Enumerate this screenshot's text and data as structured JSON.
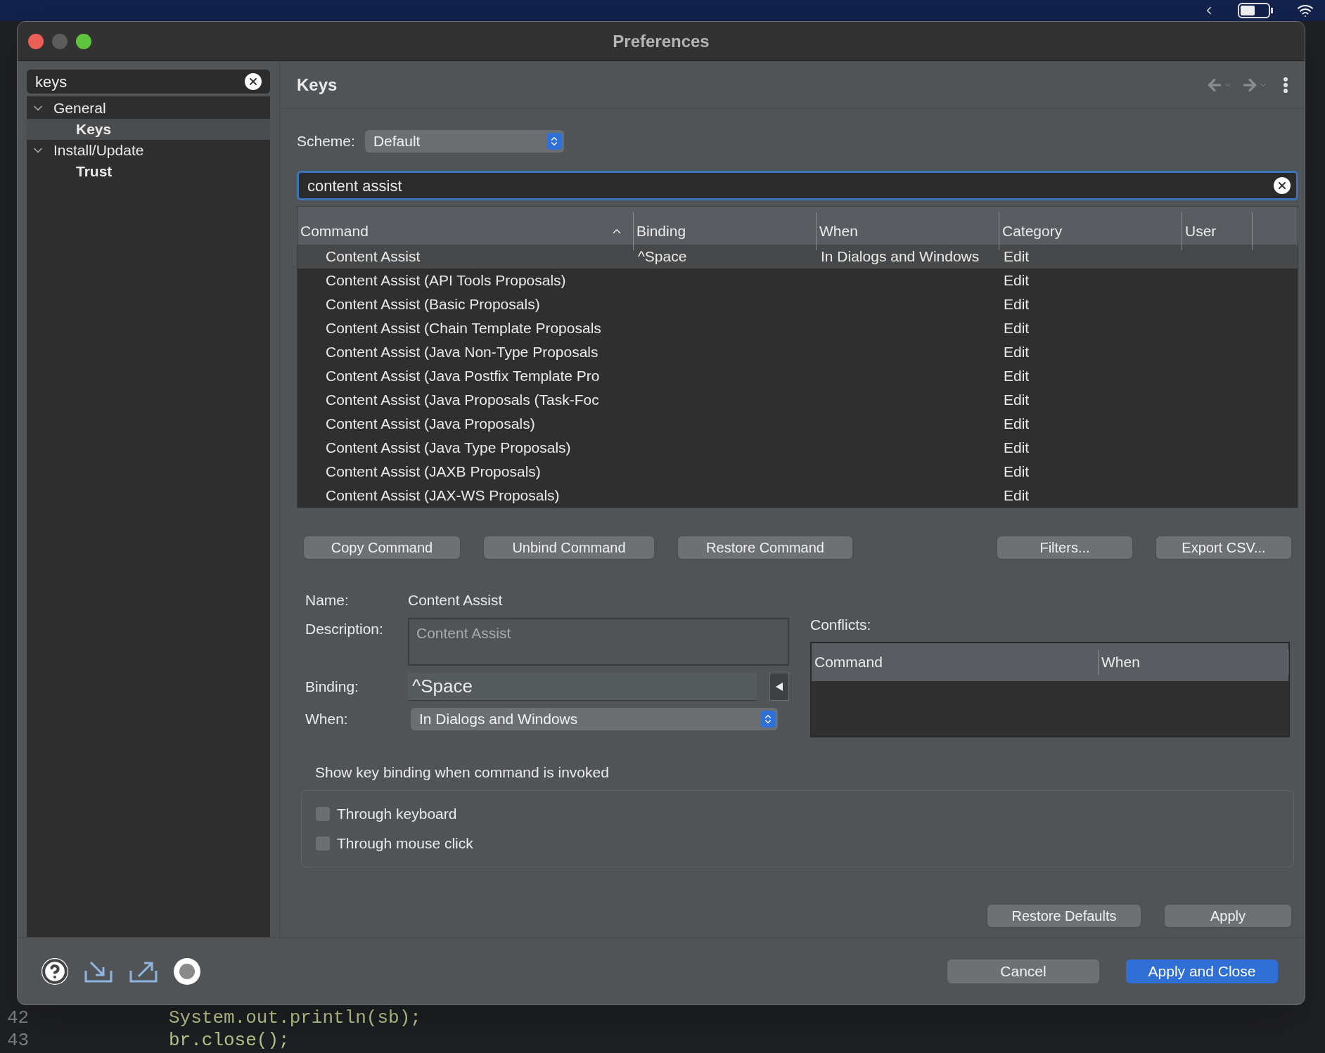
{
  "desktop": {
    "code_lines": [
      {
        "number": "42",
        "text": "System.out.println(sb);"
      },
      {
        "number": "43",
        "text": "br.close();"
      }
    ]
  },
  "window": {
    "title": "Preferences"
  },
  "sidebar": {
    "filter": {
      "value": "keys"
    },
    "tree": [
      {
        "label": "General",
        "expanded": true,
        "selected": false,
        "children": [
          {
            "label": "Keys",
            "selected": true
          }
        ]
      },
      {
        "label": "Install/Update",
        "expanded": true,
        "selected": false,
        "children": [
          {
            "label": "Trust",
            "selected": false
          }
        ]
      }
    ]
  },
  "page": {
    "title": "Keys"
  },
  "scheme": {
    "label": "Scheme:",
    "value": "Default"
  },
  "filter": {
    "value": "content assist"
  },
  "table": {
    "columns": [
      {
        "label": "Command",
        "sorted": true
      },
      {
        "label": "Binding",
        "sorted": false
      },
      {
        "label": "When",
        "sorted": false
      },
      {
        "label": "Category",
        "sorted": false
      },
      {
        "label": "User",
        "sorted": false
      }
    ],
    "rows": [
      {
        "command": "Content Assist",
        "binding": "^Space",
        "when": "In Dialogs and Windows",
        "category": "Edit",
        "selected": true
      },
      {
        "command": "Content Assist (API Tools Proposals)",
        "category": "Edit",
        "selected": false
      },
      {
        "command": "Content Assist (Basic Proposals)",
        "category": "Edit",
        "selected": false
      },
      {
        "command": "Content Assist (Chain Template Proposals",
        "category": "Edit",
        "selected": false
      },
      {
        "command": "Content Assist (Java Non-Type Proposals",
        "category": "Edit",
        "selected": false
      },
      {
        "command": "Content Assist (Java Postfix Template Pro",
        "category": "Edit",
        "selected": false
      },
      {
        "command": "Content Assist (Java Proposals (Task-Foc",
        "category": "Edit",
        "selected": false
      },
      {
        "command": "Content Assist (Java Proposals)",
        "category": "Edit",
        "selected": false
      },
      {
        "command": "Content Assist (Java Type Proposals)",
        "category": "Edit",
        "selected": false
      },
      {
        "command": "Content Assist (JAXB Proposals)",
        "category": "Edit",
        "selected": false
      },
      {
        "command": "Content Assist (JAX-WS Proposals)",
        "category": "Edit",
        "selected": false
      }
    ]
  },
  "actions": [
    "Copy Command",
    "Unbind Command",
    "Restore Command"
  ],
  "actions_right": [
    "Filters...",
    "Export CSV..."
  ],
  "details": {
    "name_label": "Name:",
    "name": "Content Assist",
    "description_label": "Description:",
    "description": "Content Assist",
    "binding_label": "Binding:",
    "binding": "^Space",
    "when_label": "When:",
    "when": "In Dialogs and Windows"
  },
  "conflicts": {
    "label": "Conflicts:",
    "columns": [
      "Command",
      "When"
    ]
  },
  "show_binding": {
    "label": "Show key binding when command is invoked",
    "options": [
      {
        "label": "Through keyboard",
        "checked": false
      },
      {
        "label": "Through mouse click",
        "checked": false
      }
    ]
  },
  "page_buttons": [
    "Restore Defaults",
    "Apply"
  ],
  "footer": {
    "buttons": [
      {
        "label": "Cancel",
        "primary": false
      },
      {
        "label": "Apply and Close",
        "primary": true
      }
    ]
  }
}
